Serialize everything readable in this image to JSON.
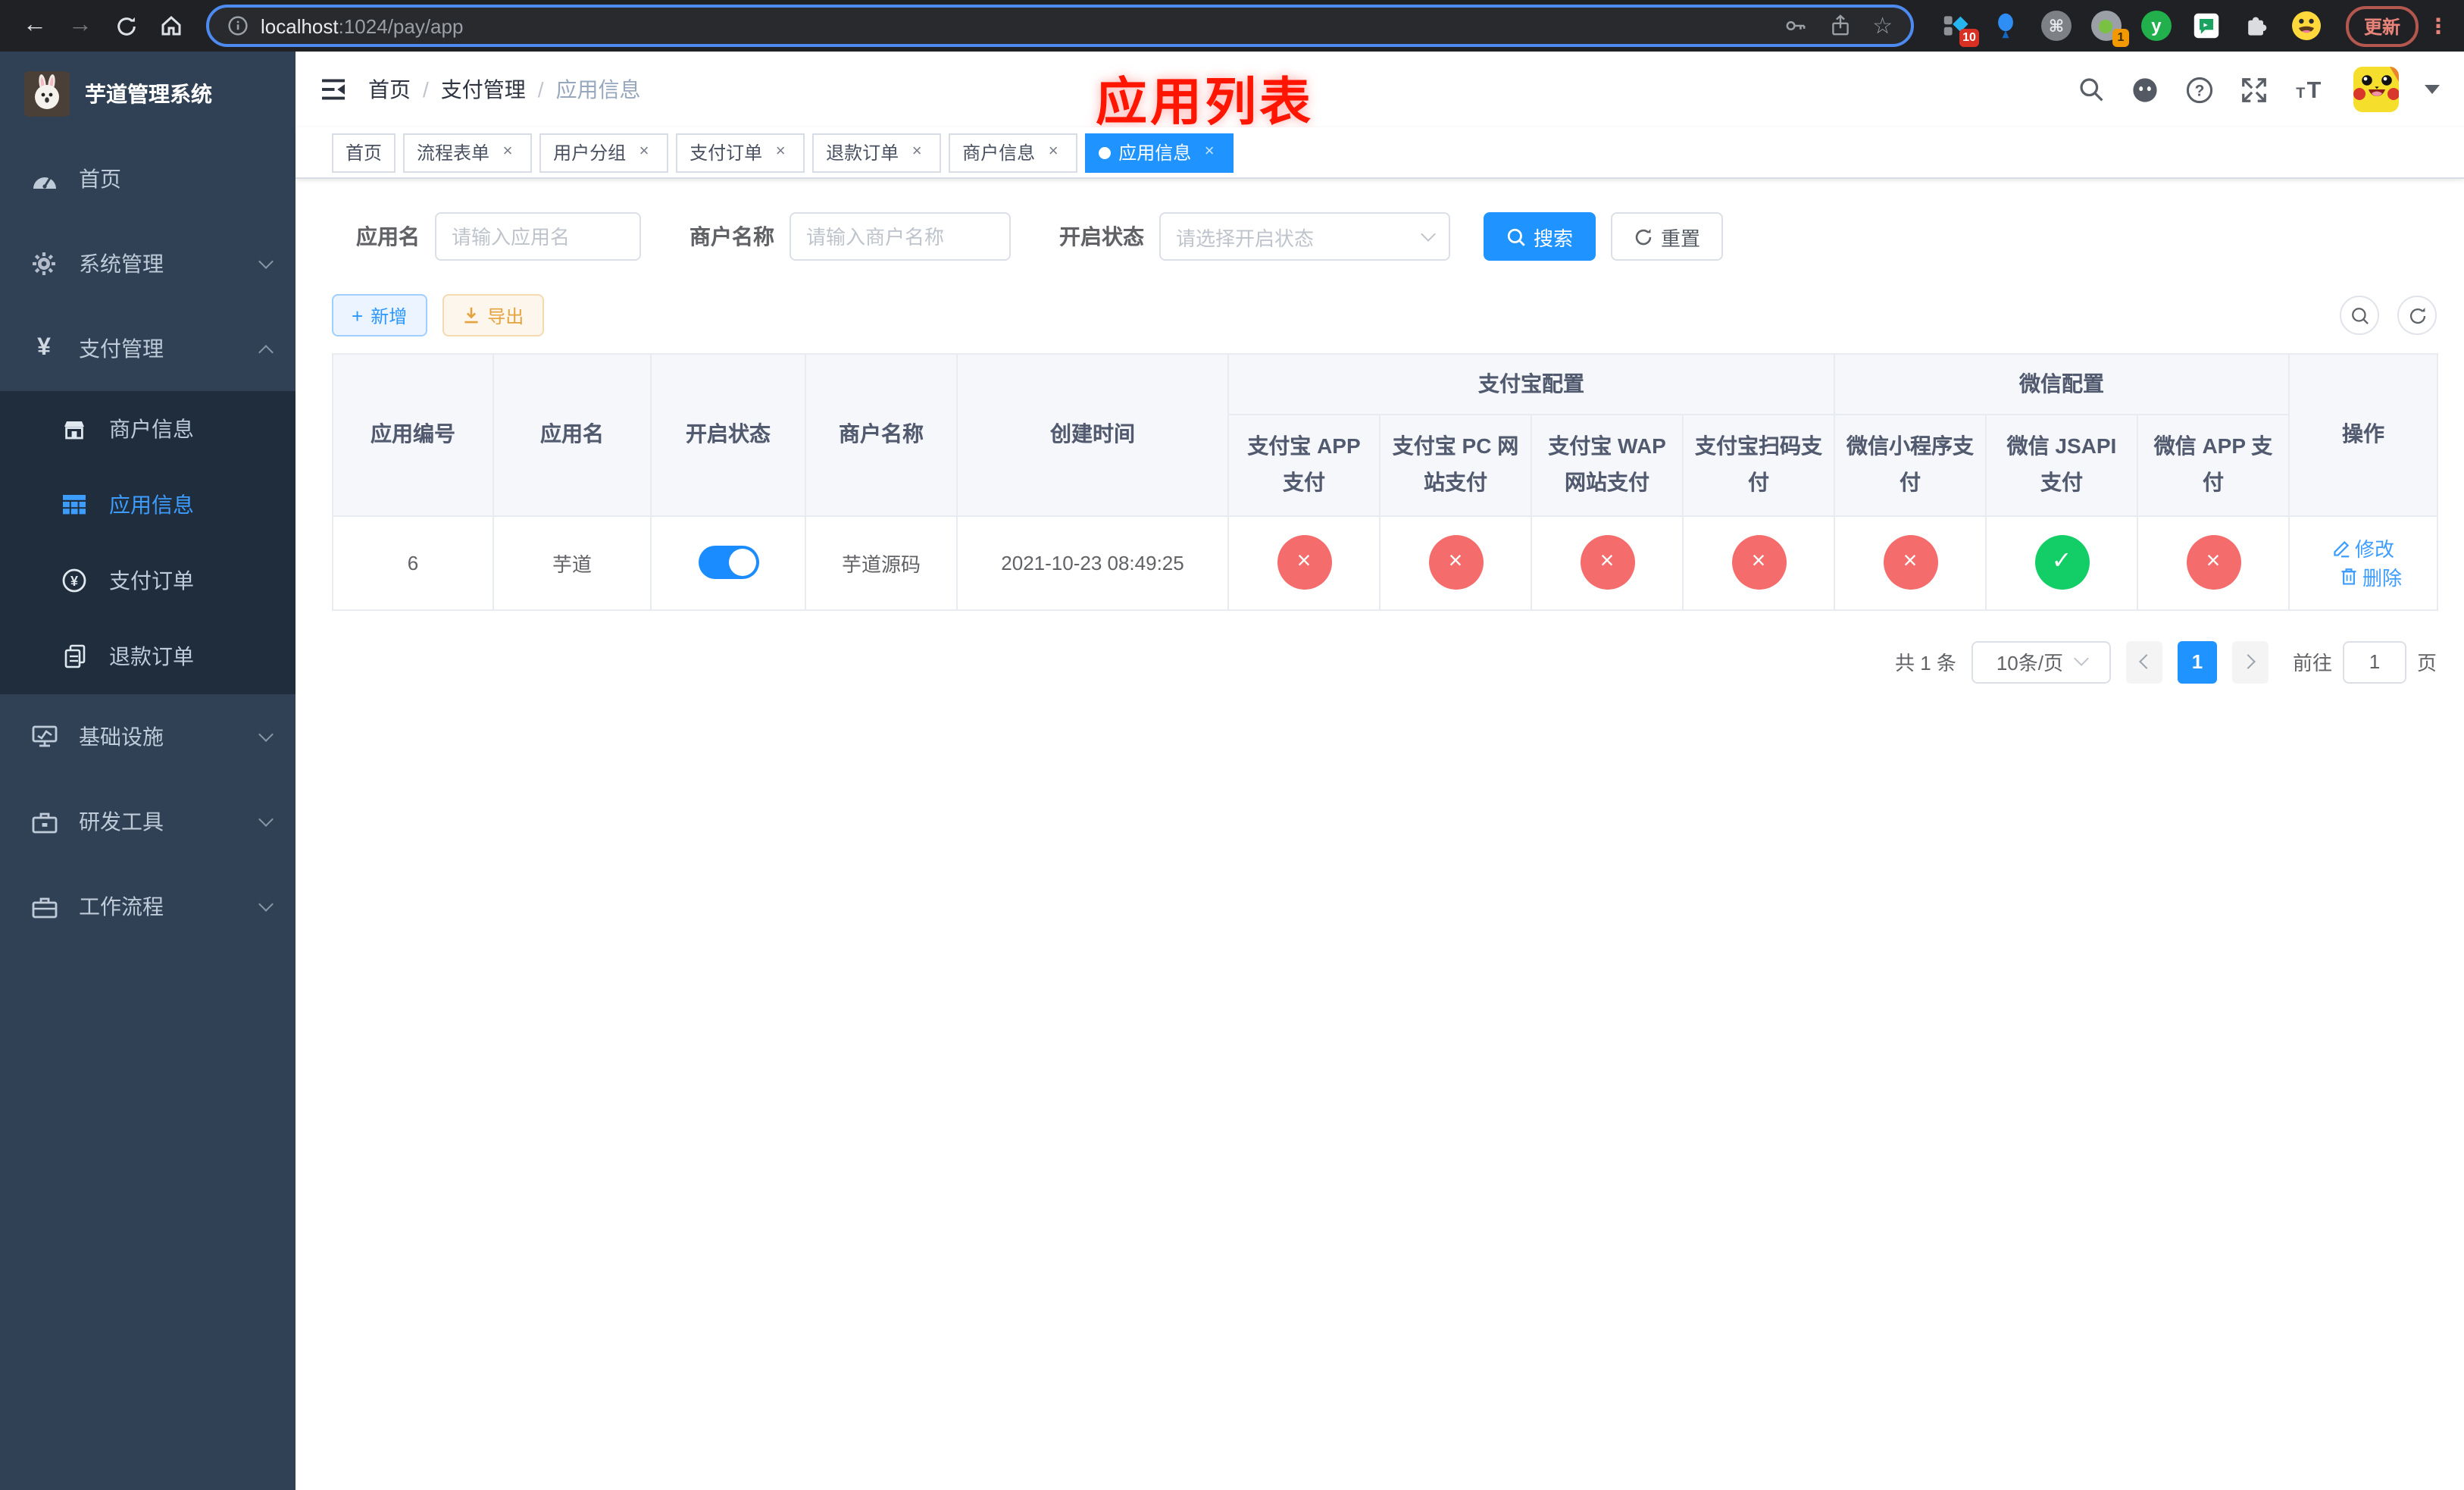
{
  "browser": {
    "url_host": "localhost",
    "url_rest": ":1024/pay/app",
    "update_label": "更新",
    "badge_kanban": "10",
    "badge_monkey": "1"
  },
  "sidebar": {
    "logo_title": "芋道管理系统",
    "menu": [
      {
        "label": "首页"
      },
      {
        "label": "系统管理"
      },
      {
        "label": "支付管理"
      },
      {
        "label": "基础设施"
      },
      {
        "label": "研发工具"
      },
      {
        "label": "工作流程"
      }
    ],
    "submenu": [
      {
        "label": "商户信息"
      },
      {
        "label": "应用信息"
      },
      {
        "label": "支付订单"
      },
      {
        "label": "退款订单"
      }
    ]
  },
  "header": {
    "breadcrumb": [
      "首页",
      "支付管理",
      "应用信息"
    ],
    "annotation": "应用列表"
  },
  "tabs": [
    {
      "label": "首页",
      "closable": false,
      "active": false
    },
    {
      "label": "流程表单",
      "closable": true,
      "active": false
    },
    {
      "label": "用户分组",
      "closable": true,
      "active": false
    },
    {
      "label": "支付订单",
      "closable": true,
      "active": false
    },
    {
      "label": "退款订单",
      "closable": true,
      "active": false
    },
    {
      "label": "商户信息",
      "closable": true,
      "active": false
    },
    {
      "label": "应用信息",
      "closable": true,
      "active": true
    }
  ],
  "filters": {
    "app_name_label": "应用名",
    "app_name_placeholder": "请输入应用名",
    "merchant_label": "商户名称",
    "merchant_placeholder": "请输入商户名称",
    "status_label": "开启状态",
    "status_placeholder": "请选择开启状态",
    "search_label": "搜索",
    "reset_label": "重置"
  },
  "toolbar": {
    "add_label": "新增",
    "export_label": "导出"
  },
  "table": {
    "columns": [
      "应用编号",
      "应用名",
      "开启状态",
      "商户名称",
      "创建时间"
    ],
    "group_alipay": "支付宝配置",
    "group_wechat": "微信配置",
    "alipay_cols": [
      "支付宝 APP 支付",
      "支付宝 PC 网站支付",
      "支付宝 WAP 网站支付",
      "支付宝扫码支付"
    ],
    "wechat_cols": [
      "微信小程序支付",
      "微信 JSAPI 支付",
      "微信 APP 支付"
    ],
    "ops_col": "操作",
    "row": {
      "app_no": "6",
      "app_name": "芋道",
      "status_on": true,
      "merchant": "芋道源码",
      "created_at": "2021-10-23 08:49:25",
      "channels": [
        "no",
        "no",
        "no",
        "no",
        "no",
        "yes",
        "no"
      ],
      "op_edit": "修改",
      "op_delete": "删除"
    }
  },
  "pagination": {
    "total": "共 1 条",
    "page_size": "10条/页",
    "current_page": "1",
    "goto_label": "前往",
    "goto_value": "1",
    "goto_unit": "页"
  }
}
